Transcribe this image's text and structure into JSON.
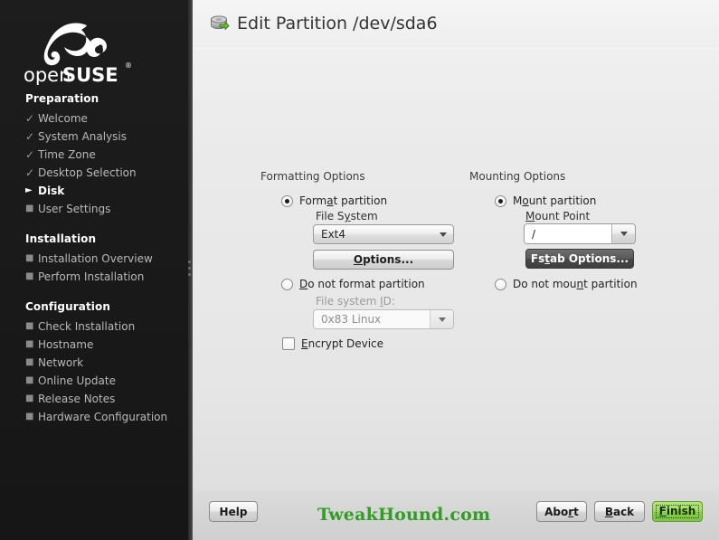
{
  "sidebar": {
    "logo_text_top": "open",
    "logo_text_bottom": "SUSE",
    "sections": [
      {
        "heading": "Preparation",
        "items": [
          {
            "label": "Welcome",
            "state": "done",
            "marker": "check-icon"
          },
          {
            "label": "System Analysis",
            "state": "done",
            "marker": "check-icon"
          },
          {
            "label": "Time Zone",
            "state": "done",
            "marker": "check-icon"
          },
          {
            "label": "Desktop Selection",
            "state": "done",
            "marker": "check-icon"
          },
          {
            "label": "Disk",
            "state": "current",
            "marker": "arrow-right-icon"
          },
          {
            "label": "User Settings",
            "state": "pending",
            "marker": "bullet-icon"
          }
        ]
      },
      {
        "heading": "Installation",
        "items": [
          {
            "label": "Installation Overview",
            "state": "pending",
            "marker": "bullet-icon"
          },
          {
            "label": "Perform Installation",
            "state": "pending",
            "marker": "bullet-icon"
          }
        ]
      },
      {
        "heading": "Configuration",
        "items": [
          {
            "label": "Check Installation",
            "state": "pending",
            "marker": "bullet-icon"
          },
          {
            "label": "Hostname",
            "state": "pending",
            "marker": "bullet-icon"
          },
          {
            "label": "Network",
            "state": "pending",
            "marker": "bullet-icon"
          },
          {
            "label": "Online Update",
            "state": "pending",
            "marker": "bullet-icon"
          },
          {
            "label": "Release Notes",
            "state": "pending",
            "marker": "bullet-icon"
          },
          {
            "label": "Hardware Configuration",
            "state": "pending",
            "marker": "bullet-icon"
          }
        ]
      }
    ]
  },
  "header": {
    "title": "Edit Partition /dev/sda6",
    "icon": "hard-disk-icon"
  },
  "formatting": {
    "group_label": "Formatting Options",
    "format_radio": {
      "label": "Format partition",
      "accel": "a",
      "selected": true
    },
    "filesystem_label": "File System",
    "filesystem_accel": "y",
    "filesystem_value": "Ext4",
    "options_button": "Options...",
    "options_accel": "O",
    "do_not_format_radio": {
      "label": "Do not format partition",
      "accel": "D",
      "selected": false
    },
    "fsid_label": "File system ID:",
    "fsid_accel": "I",
    "fsid_value": "0x83 Linux",
    "fsid_disabled": true,
    "encrypt_checkbox": {
      "label": "Encrypt Device",
      "accel": "E",
      "checked": false
    }
  },
  "mounting": {
    "group_label": "Mounting Options",
    "mount_radio": {
      "label": "Mount partition",
      "accel": "o",
      "selected": true
    },
    "mountpoint_label": "Mount Point",
    "mountpoint_accel": "M",
    "mountpoint_value": "/",
    "fstab_button": "Fstab Options...",
    "fstab_accel": "t",
    "do_not_mount_radio": {
      "label": "Do not mount partition",
      "accel": "n",
      "selected": false
    }
  },
  "footer": {
    "help_button": "Help",
    "watermark": "TweakHound.com",
    "abort_button": "Abort",
    "abort_accel": "r",
    "back_button": "Back",
    "back_accel": "B",
    "finish_button": "Finish",
    "finish_accel": "F",
    "finish_focused": true
  },
  "colors": {
    "sidebar_bg": "#1b1b1b",
    "main_bg": "#e9e9e9",
    "accent_green": "#2f9e22",
    "finish_green": "#8ace46"
  }
}
